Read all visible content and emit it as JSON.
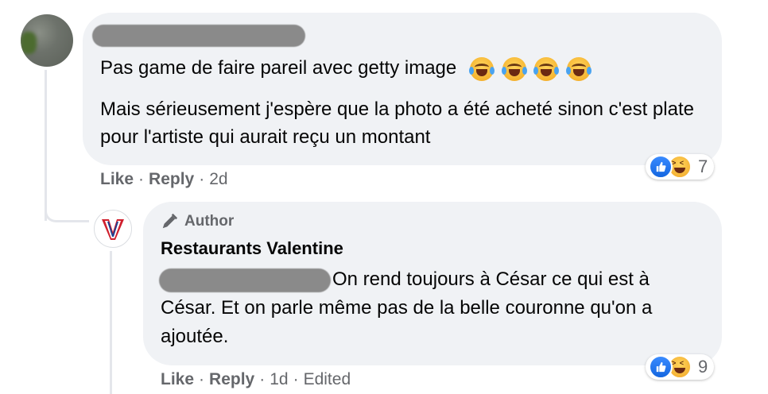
{
  "comment": {
    "text_line1": "Pas game de faire pareil avec getty image",
    "emoji_icons": [
      "laughing-tears-icon",
      "laughing-tears-icon",
      "laughing-tears-icon",
      "laughing-tears-icon"
    ],
    "text_para": "Mais sérieusement j'espère que la photo a été acheté sinon c'est plate pour l'artiste qui aurait reçu un montant",
    "actions": {
      "like": "Like",
      "reply": "Reply",
      "age": "2d",
      "sep": "·"
    },
    "reactions": {
      "icons": [
        "like-reaction-icon",
        "haha-reaction-icon"
      ],
      "count": "7"
    }
  },
  "reply": {
    "badge": "Author",
    "author_name": "Restaurants Valentine",
    "text": "On rend toujours à César ce qui est à César. Et on parle même pas de la belle couronne qu'on a ajoutée.",
    "actions": {
      "like": "Like",
      "reply": "Reply",
      "age": "1d",
      "edited": "Edited",
      "sep": "·"
    },
    "reactions": {
      "icons": [
        "like-reaction-icon",
        "haha-reaction-icon"
      ],
      "count": "9"
    }
  },
  "colors": {
    "bubble": "#f0f2f5",
    "meta_text": "#65676b",
    "like_blue": "#1877f2",
    "brand_red": "#d0202e",
    "brand_blue": "#1f3f8f"
  }
}
